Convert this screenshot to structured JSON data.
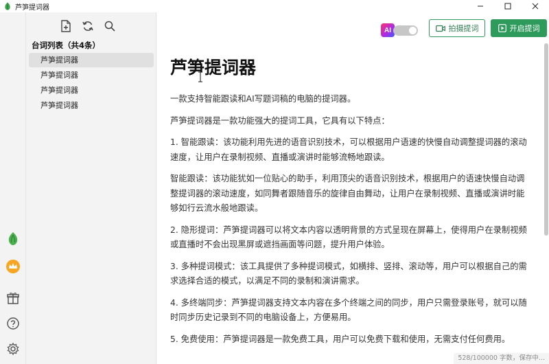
{
  "window": {
    "title": "芦笋提词器"
  },
  "toolbar": {
    "new_icon": "file-add-icon",
    "refresh_icon": "refresh-icon",
    "search_icon": "search-icon"
  },
  "list": {
    "heading": "台词列表（共4条）",
    "items": [
      {
        "label": "芦笋提词器"
      },
      {
        "label": "芦笋提词器"
      },
      {
        "label": "芦笋提词器"
      },
      {
        "label": "芦笋提词器"
      }
    ]
  },
  "header": {
    "ai_badge": "AI",
    "capture_label": "拍摄提词",
    "start_label": "开启提词"
  },
  "document": {
    "title": "芦笋提词器",
    "paragraphs": [
      "一款支持智能跟读和AI写题词稿的电脑的提词器。",
      "芦笋提词器是一款功能强大的提词工具，它具有以下特点：",
      "1. 智能跟读：该功能利用先进的语音识别技术，可以根据用户语速的快慢自动调整提词器的滚动速度，让用户在录制视频、直播或演讲时能够流畅地跟读。",
      "智能跟读：该功能犹如一位贴心的助手，利用顶尖的语音识别技术，根据用户的语速快慢自动调整提词器的滚动速度，如同舞者跟随音乐的旋律自由舞动，让用户在录制视频、直播或演讲时能够如行云流水般地跟读。",
      "2. 隐形提词：芦笋提词器可以将文本内容以透明背景的方式呈现在屏幕上，使得用户在录制视频或直播时不会出现黑屏或遮挡画面等问题，提升用户体验。",
      "3. 多种提词模式：该工具提供了多种提词模式，如横排、竖排、滚动等，用户可以根据自己的需求选择合适的模式，以满足不同的录制和演讲需求。",
      "4. 多终端同步：芦笋提词器支持文本内容在多个终端之间的同步，用户只需登录账号，就可以随时同步历史记录到不同的电脑设备上，方便易用。",
      "5. 免费使用：芦笋提词器是一款免费工具，用户可以免费下载和使用，无需支付任何费用。"
    ]
  },
  "status": {
    "text": "528/100000 字数，保存中..."
  },
  "colors": {
    "accent": "#2e9a5c",
    "rail_bg": "#f3f3f3",
    "selected_bg": "#e0e0e0"
  }
}
